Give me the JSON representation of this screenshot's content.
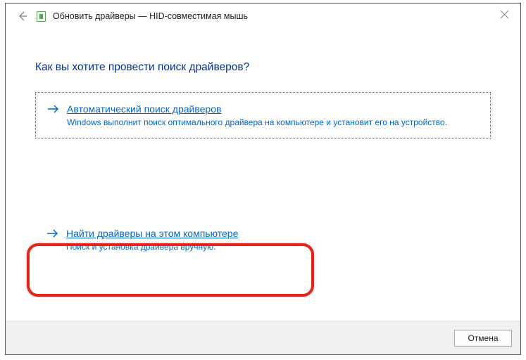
{
  "titlebar": {
    "title": "Обновить драйверы — HID-совместимая мышь"
  },
  "content": {
    "heading": "Как вы хотите провести поиск драйверов?",
    "options": [
      {
        "title": "Автоматический поиск драйверов",
        "desc": "Windows выполнит поиск оптимального драйвера на компьютере и установит его на устройство."
      },
      {
        "title": "Найти драйверы на этом компьютере",
        "desc": "Поиск и установка драйвера вручную."
      }
    ]
  },
  "footer": {
    "cancel": "Отмена"
  }
}
